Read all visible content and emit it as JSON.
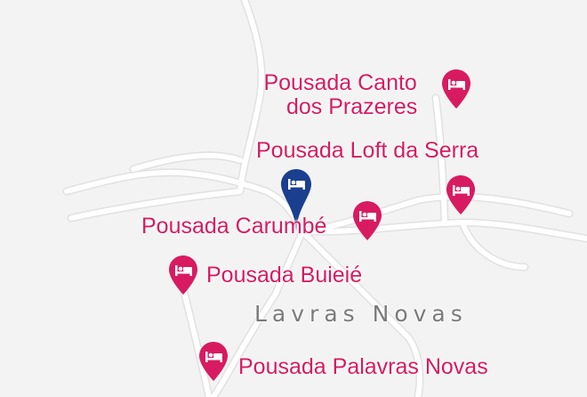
{
  "map": {
    "town_label": "Lavras Novas",
    "colors": {
      "poi": "#d81b60",
      "selected": "#1a3f8f",
      "background": "#f3f3f3",
      "road": "#ffffff"
    },
    "pins": [
      {
        "label": "Pousada Canto",
        "label2": "dos Prazeres",
        "icon": "hotel-bed-icon",
        "color": "#d81b60"
      },
      {
        "label": "Pousada Loft da Serra",
        "icon": "hotel-bed-icon",
        "color": "#d81b60"
      },
      {
        "label": "Pousada Carumbé",
        "icon": "hotel-bed-icon",
        "color": "#d81b60"
      },
      {
        "label": "Pousada Buieié",
        "icon": "hotel-bed-icon",
        "color": "#d81b60"
      },
      {
        "label": "Pousada Palavras Novas",
        "icon": "hotel-bed-icon",
        "color": "#d81b60"
      }
    ],
    "selected_pin": {
      "icon": "hotel-bed-icon",
      "color": "#1a3f8f"
    }
  }
}
